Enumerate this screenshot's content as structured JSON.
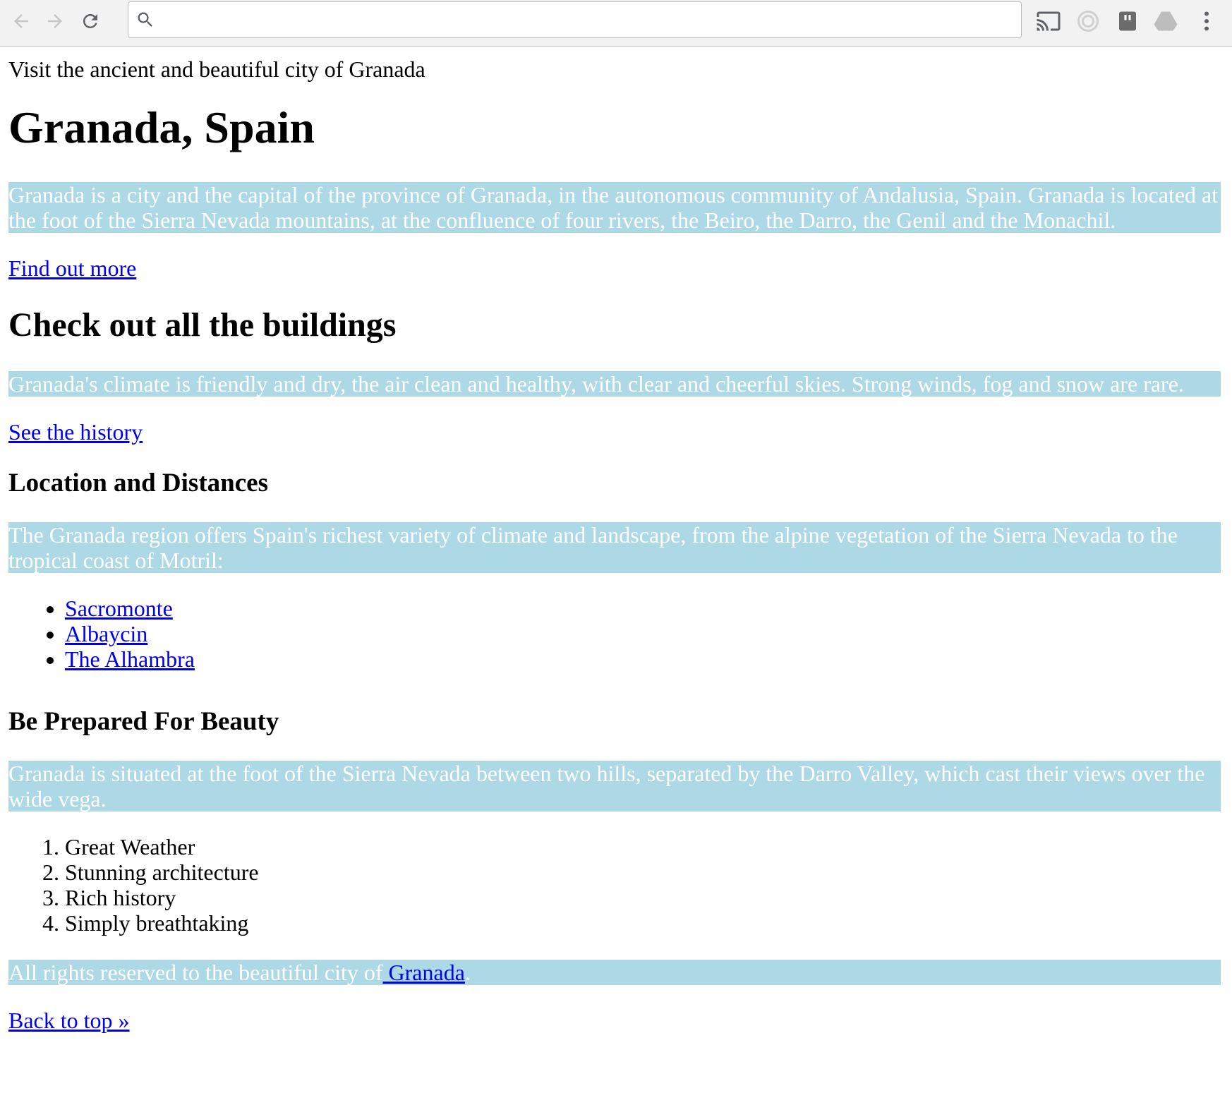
{
  "browser": {
    "address_value": "",
    "back_icon": "arrow-left-icon",
    "forward_icon": "arrow-right-icon",
    "reload_icon": "reload-icon",
    "search_icon": "search-icon",
    "extensions": [
      "cast-icon",
      "circle-extension-icon",
      "evernote-icon",
      "drive-icon",
      "more-vert-icon"
    ]
  },
  "page": {
    "tagline": "Visit the ancient and beautiful city of Granada",
    "title": "Granada, Spain",
    "intro": "Granada is a city and the capital of the province of Granada, in the autonomous community of Andalusia, Spain. Granada is located at the foot of the Sierra Nevada mountains, at the confluence of four rivers, the Beiro, the Darro, the Genil and the Monachil.",
    "find_out_more": "Find out more",
    "buildings_heading": "Check out all the buildings",
    "climate": "Granada's climate is friendly and dry, the air clean and healthy, with clear and cheerful skies. Strong winds, fog and snow are rare.",
    "see_history": "See the history",
    "location_heading": "Location and Distances",
    "region": "The Granada region offers Spain's richest variety of climate and landscape, from the alpine vegetation of the Sierra Nevada to the tropical coast of Motril:",
    "places": [
      "Sacromonte",
      "Albaycin",
      "The Alhambra"
    ],
    "beauty_heading": "Be Prepared For Beauty",
    "situated": "Granada is situated at the foot of the Sierra Nevada between two hills, separated by the Darro Valley, which cast their views over the wide vega.",
    "reasons": [
      "Great Weather",
      "Stunning architecture",
      "Rich history",
      "Simply breathtaking"
    ],
    "footer_text": "All rights reserved to the beautiful city of",
    "footer_link": " Granada",
    "footer_end": ".",
    "back_to_top": "Back to top »"
  },
  "colors": {
    "band_background": "#add8e6",
    "band_text": "#ffffff",
    "link": "#0000ee"
  }
}
